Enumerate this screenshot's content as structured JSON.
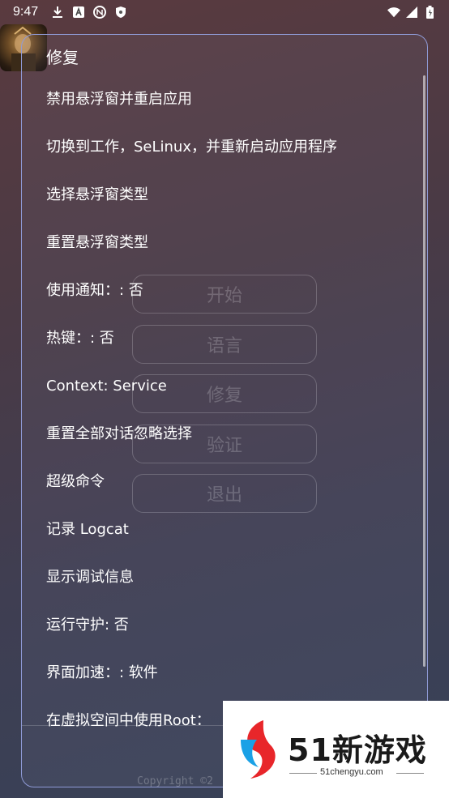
{
  "status_bar": {
    "time": "9:47",
    "left_icons": [
      "download-icon",
      "font-a-icon",
      "nfc-icon",
      "shield-icon"
    ],
    "right_icons": [
      "wifi-icon",
      "signal-icon",
      "battery-icon"
    ]
  },
  "background_buttons": [
    "开始",
    "语言",
    "修复",
    "验证",
    "退出"
  ],
  "dialog": {
    "title": "修复",
    "items": [
      "禁用悬浮窗并重启应用",
      "切换到工作，SeLinux，并重新启动应用程序",
      "选择悬浮窗类型",
      "重置悬浮窗类型",
      "使用通知：: 否",
      "热键：: 否",
      "Context: Service",
      "重置全部对话忽略选择",
      "超级命令",
      "记录 Logcat",
      "显示调试信息",
      "运行守护: 否",
      "界面加速：: 软件",
      "在虚拟空间中使用Root："
    ],
    "footer": "Copyright ©2"
  },
  "watermark": {
    "brand": "51新游戏",
    "url": "51chengyu.com",
    "colors": {
      "red": "#e8262a",
      "blue": "#1aa1e6"
    }
  }
}
